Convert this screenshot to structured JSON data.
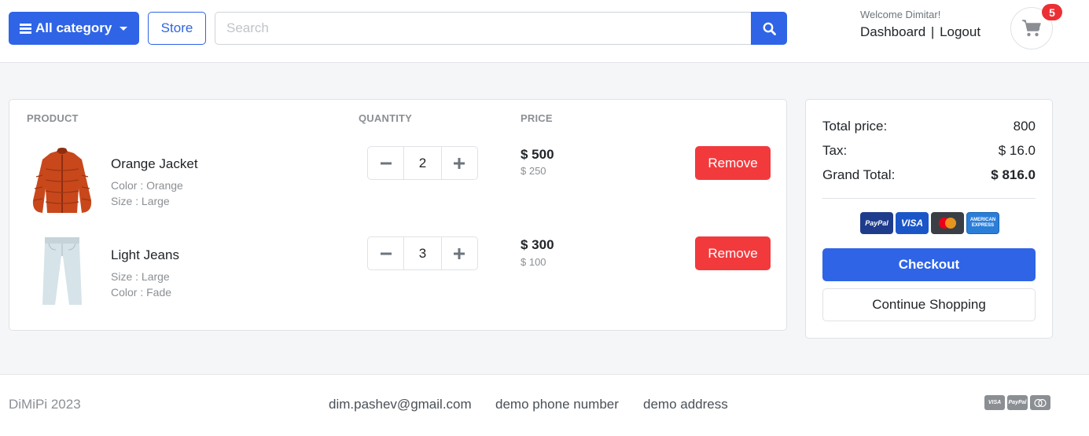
{
  "header": {
    "category_label": "All category",
    "store_label": "Store",
    "search_placeholder": "Search",
    "search_value": "",
    "welcome": "Welcome Dimitar!",
    "dashboard_label": "Dashboard",
    "separator": "|",
    "logout_label": "Logout",
    "cart_count": "5"
  },
  "cart": {
    "columns": {
      "product": "PRODUCT",
      "quantity": "QUANTITY",
      "price": "PRICE"
    },
    "items": [
      {
        "name": "Orange Jacket",
        "attr1": "Color : Orange",
        "attr2": "Size : Large",
        "quantity": "2",
        "total_price": "$ 500",
        "unit_price": "$ 250",
        "remove_label": "Remove",
        "thumb": "orange-jacket-image"
      },
      {
        "name": "Light Jeans",
        "attr1": "Size : Large",
        "attr2": "Color : Fade",
        "quantity": "3",
        "total_price": "$ 300",
        "unit_price": "$ 100",
        "remove_label": "Remove",
        "thumb": "light-jeans-image"
      }
    ]
  },
  "summary": {
    "total_label": "Total price:",
    "total_value": "800",
    "tax_label": "Tax:",
    "tax_value": "$ 16.0",
    "grand_label": "Grand Total:",
    "grand_value": "$ 816.0",
    "payment_icons": [
      "paypal-icon",
      "visa-icon",
      "mastercard-icon",
      "amex-icon"
    ],
    "paypal_text": "PayPal",
    "visa_text": "VISA",
    "amex_text": "AMERICAN EXPRESS",
    "checkout_label": "Checkout",
    "continue_label": "Continue Shopping"
  },
  "footer": {
    "brand": "DiMiPi 2023",
    "email": "dim.pashev@gmail.com",
    "phone": "demo phone number",
    "address": "demo address",
    "visa_text": "VISA",
    "paypal_text": "PayPal"
  },
  "colors": {
    "primary": "#2f64e6",
    "danger": "#f23a3d",
    "badge": "#ec2f34",
    "background": "#f5f6f8"
  }
}
